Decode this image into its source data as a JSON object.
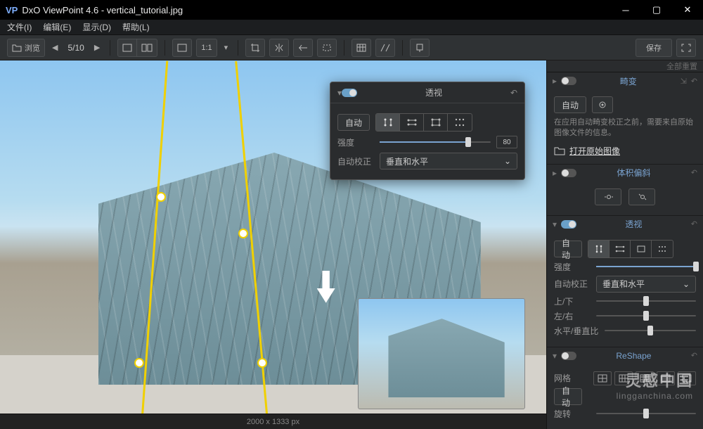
{
  "titlebar": {
    "prefix": "VP",
    "title": "DxO ViewPoint 4.6 - vertical_tutorial.jpg"
  },
  "menu": {
    "file": "文件(I)",
    "edit": "编辑(E)",
    "view": "显示(D)",
    "help": "帮助(L)"
  },
  "toolbar": {
    "browse": "浏览",
    "page_current": "5",
    "page_sep": "/",
    "page_total": "10",
    "fit_label": "1:1",
    "save": "保存"
  },
  "reset_label": "全部重置",
  "floating_panel": {
    "title": "透视",
    "auto": "自动",
    "intensity_label": "强度",
    "intensity_value": "80",
    "autocorrect_label": "自动校正",
    "autocorrect_value": "垂直和水平"
  },
  "statusbar": {
    "dims": "2000 x 1333 px"
  },
  "panels": {
    "distortion": {
      "title": "畸变",
      "auto_btn": "自动",
      "info": "在应用自动畸变校正之前，需要来自原始图像文件的信息。",
      "open_link": "打开原始图像"
    },
    "volume": {
      "title": "体积偏斜"
    },
    "perspective": {
      "title": "透视",
      "auto_btn": "自动",
      "intensity_label": "强度",
      "autocorrect_label": "自动校正",
      "autocorrect_value": "垂直和水平",
      "up_down": "上/下",
      "left_right": "左/右",
      "hv_ratio": "水平/垂直比"
    },
    "reshape": {
      "title": "ReShape",
      "grid_label": "网格",
      "auto_btn": "自动",
      "rotate_label": "旋转"
    }
  },
  "watermark": {
    "line1": "灵感中国",
    "line2": "lingganchina.com"
  }
}
